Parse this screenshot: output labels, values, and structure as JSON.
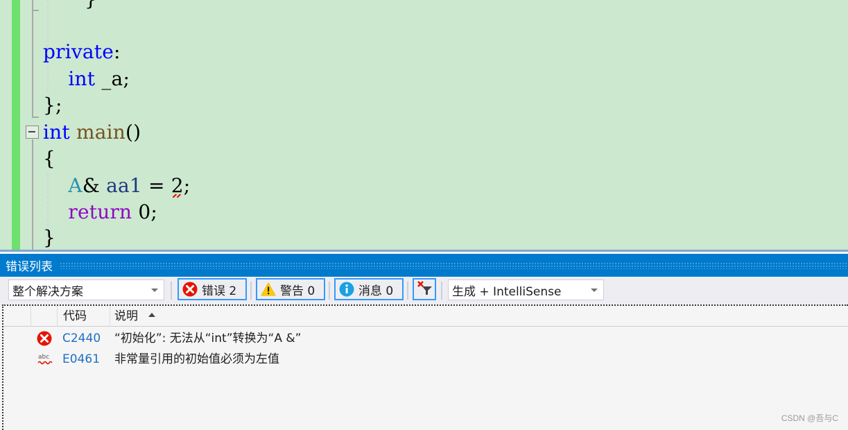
{
  "editor": {
    "lines": [
      {
        "id": "close-brace-inner",
        "tokens": [
          {
            "t": "}",
            "c": ""
          }
        ]
      },
      {
        "id": "blank",
        "tokens": []
      },
      {
        "id": "private",
        "tokens": [
          {
            "t": "private",
            "c": "kw"
          },
          {
            "t": ":",
            "c": ""
          }
        ]
      },
      {
        "id": "member",
        "tokens": [
          {
            "t": "    ",
            "c": ""
          },
          {
            "t": "int",
            "c": "kw"
          },
          {
            "t": " _a;",
            "c": ""
          }
        ]
      },
      {
        "id": "class-end",
        "tokens": [
          {
            "t": "};",
            "c": ""
          }
        ]
      },
      {
        "id": "main-decl",
        "tokens": [
          {
            "t": "int",
            "c": "kw"
          },
          {
            "t": " ",
            "c": ""
          },
          {
            "t": "main",
            "c": "fn"
          },
          {
            "t": "()",
            "c": ""
          }
        ]
      },
      {
        "id": "main-open",
        "tokens": [
          {
            "t": "{",
            "c": ""
          }
        ]
      },
      {
        "id": "ref-decl",
        "tokens": [
          {
            "t": "    ",
            "c": ""
          },
          {
            "t": "A",
            "c": "ty"
          },
          {
            "t": "& ",
            "c": ""
          },
          {
            "t": "aa1",
            "c": "var"
          },
          {
            "t": " = ",
            "c": ""
          },
          {
            "t": "2",
            "c": "sq"
          },
          {
            "t": ";",
            "c": ""
          }
        ]
      },
      {
        "id": "return",
        "tokens": [
          {
            "t": "    ",
            "c": ""
          },
          {
            "t": "return",
            "c": "ctl"
          },
          {
            "t": " 0;",
            "c": ""
          }
        ]
      },
      {
        "id": "main-close",
        "tokens": [
          {
            "t": "}",
            "c": ""
          }
        ]
      }
    ]
  },
  "panel": {
    "title": "错误列表",
    "scope_dropdown": "整个解决方案",
    "errors_button": "错误 2",
    "warnings_button": "警告 0",
    "messages_button": "消息 0",
    "source_dropdown": "生成 + IntelliSense",
    "columns": {
      "code": "代码",
      "description": "说明"
    },
    "rows": [
      {
        "icon": "error-icon",
        "code": "C2440",
        "description": "“初始化”: 无法从“int”转换为“A &”"
      },
      {
        "icon": "intellisense-squiggle-icon",
        "code": "E0461",
        "description": "非常量引用的初始值必须为左值"
      }
    ]
  },
  "watermark": "CSDN @吾与C",
  "colors": {
    "editor_bg": "#cce8cf",
    "change_bar": "#6ee06e",
    "keyword": "#0000ff",
    "function": "#74531f",
    "type": "#2b91af",
    "control": "#8f08c4",
    "panel_title_bg": "#007acc",
    "error_red": "#e51400",
    "code_link": "#1e6fc5"
  }
}
